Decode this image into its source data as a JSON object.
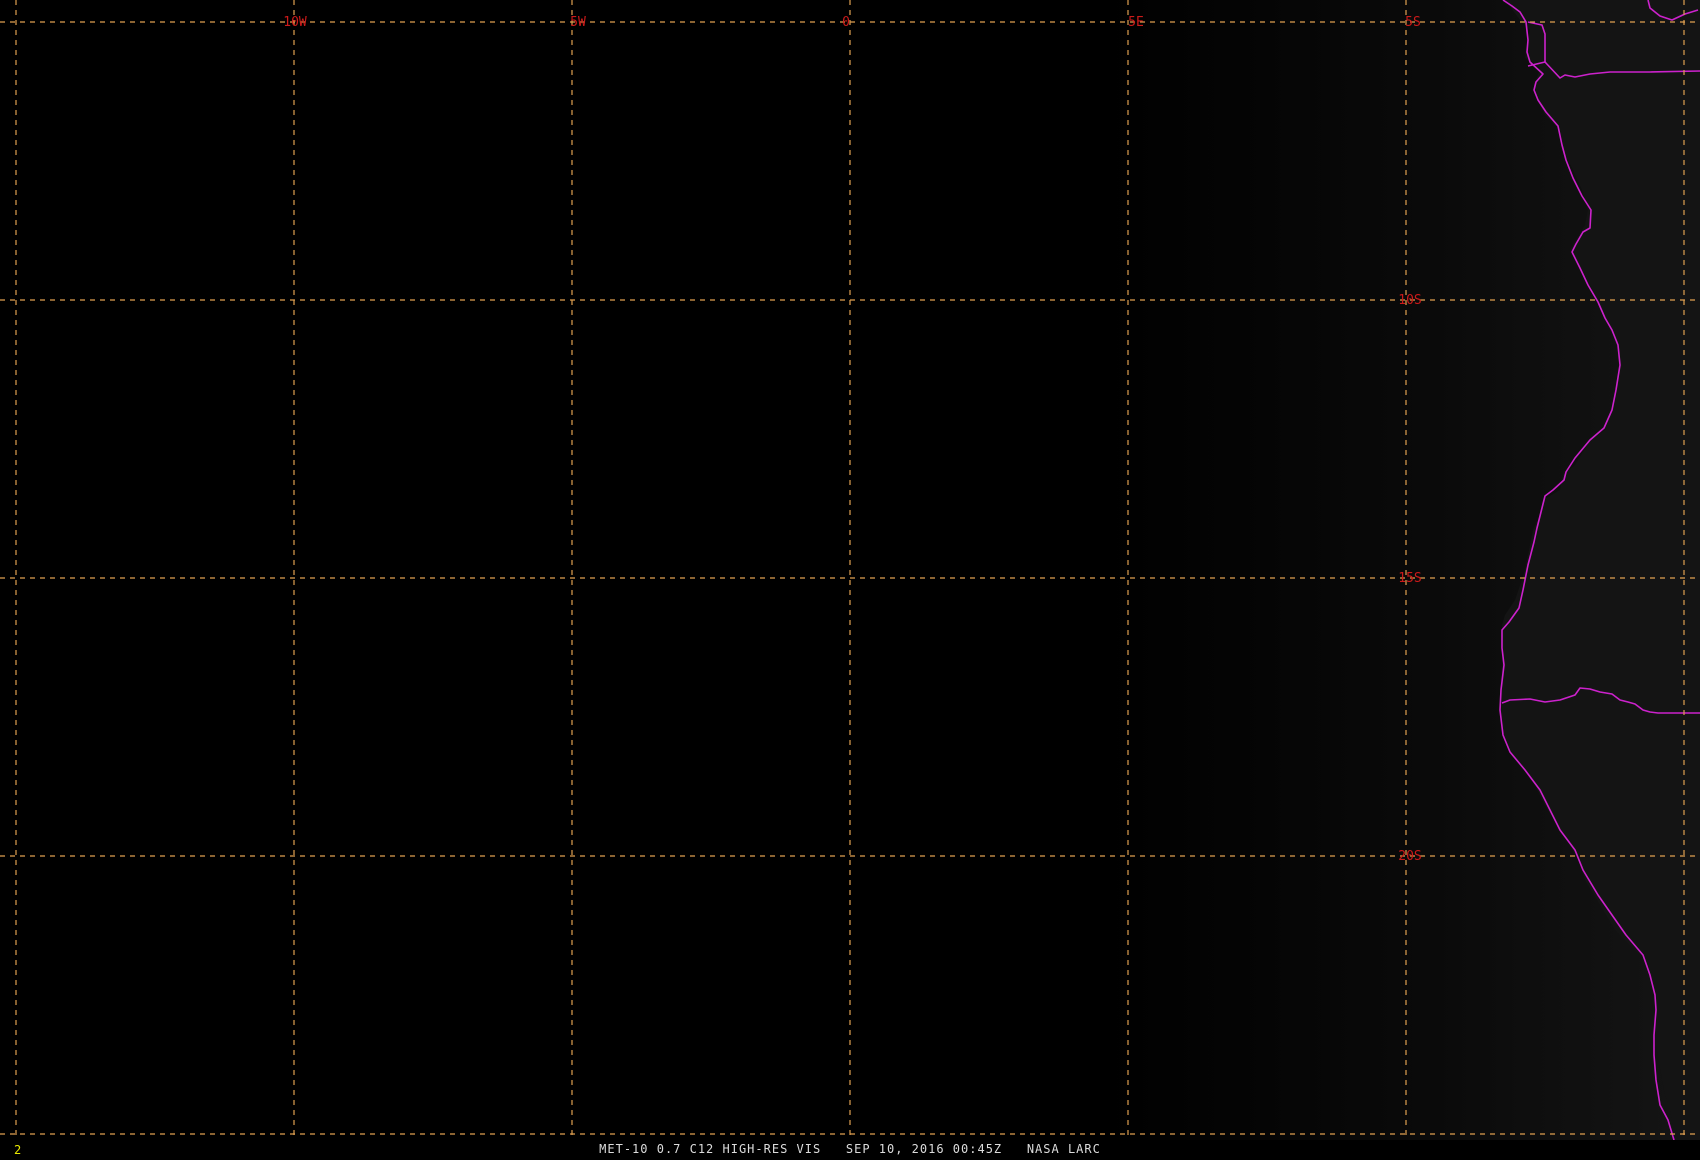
{
  "map": {
    "projection": "lat-lon",
    "region": "South Atlantic / Southwest Africa coast",
    "background_ocean": "#000000",
    "background_land": "#141414",
    "grid_color": "#e0a050",
    "label_color": "#cc1a1a",
    "coastline_color": "#cc22cc",
    "longitude_labels": [
      "10W",
      "5W",
      "0",
      "5E"
    ],
    "latitude_labels": [
      "5S",
      "10S",
      "15S",
      "20S"
    ]
  },
  "frame_number": "2",
  "caption": {
    "satellite": "MET-10",
    "channel": "0.7 C12 HIGH-RES VIS",
    "datetime": "SEP 10, 2016 00:45Z",
    "source": "NASA LARC",
    "full": "MET-10 0.7 C12 HIGH-RES VIS   SEP 10, 2016 00:45Z   NASA LARC"
  }
}
